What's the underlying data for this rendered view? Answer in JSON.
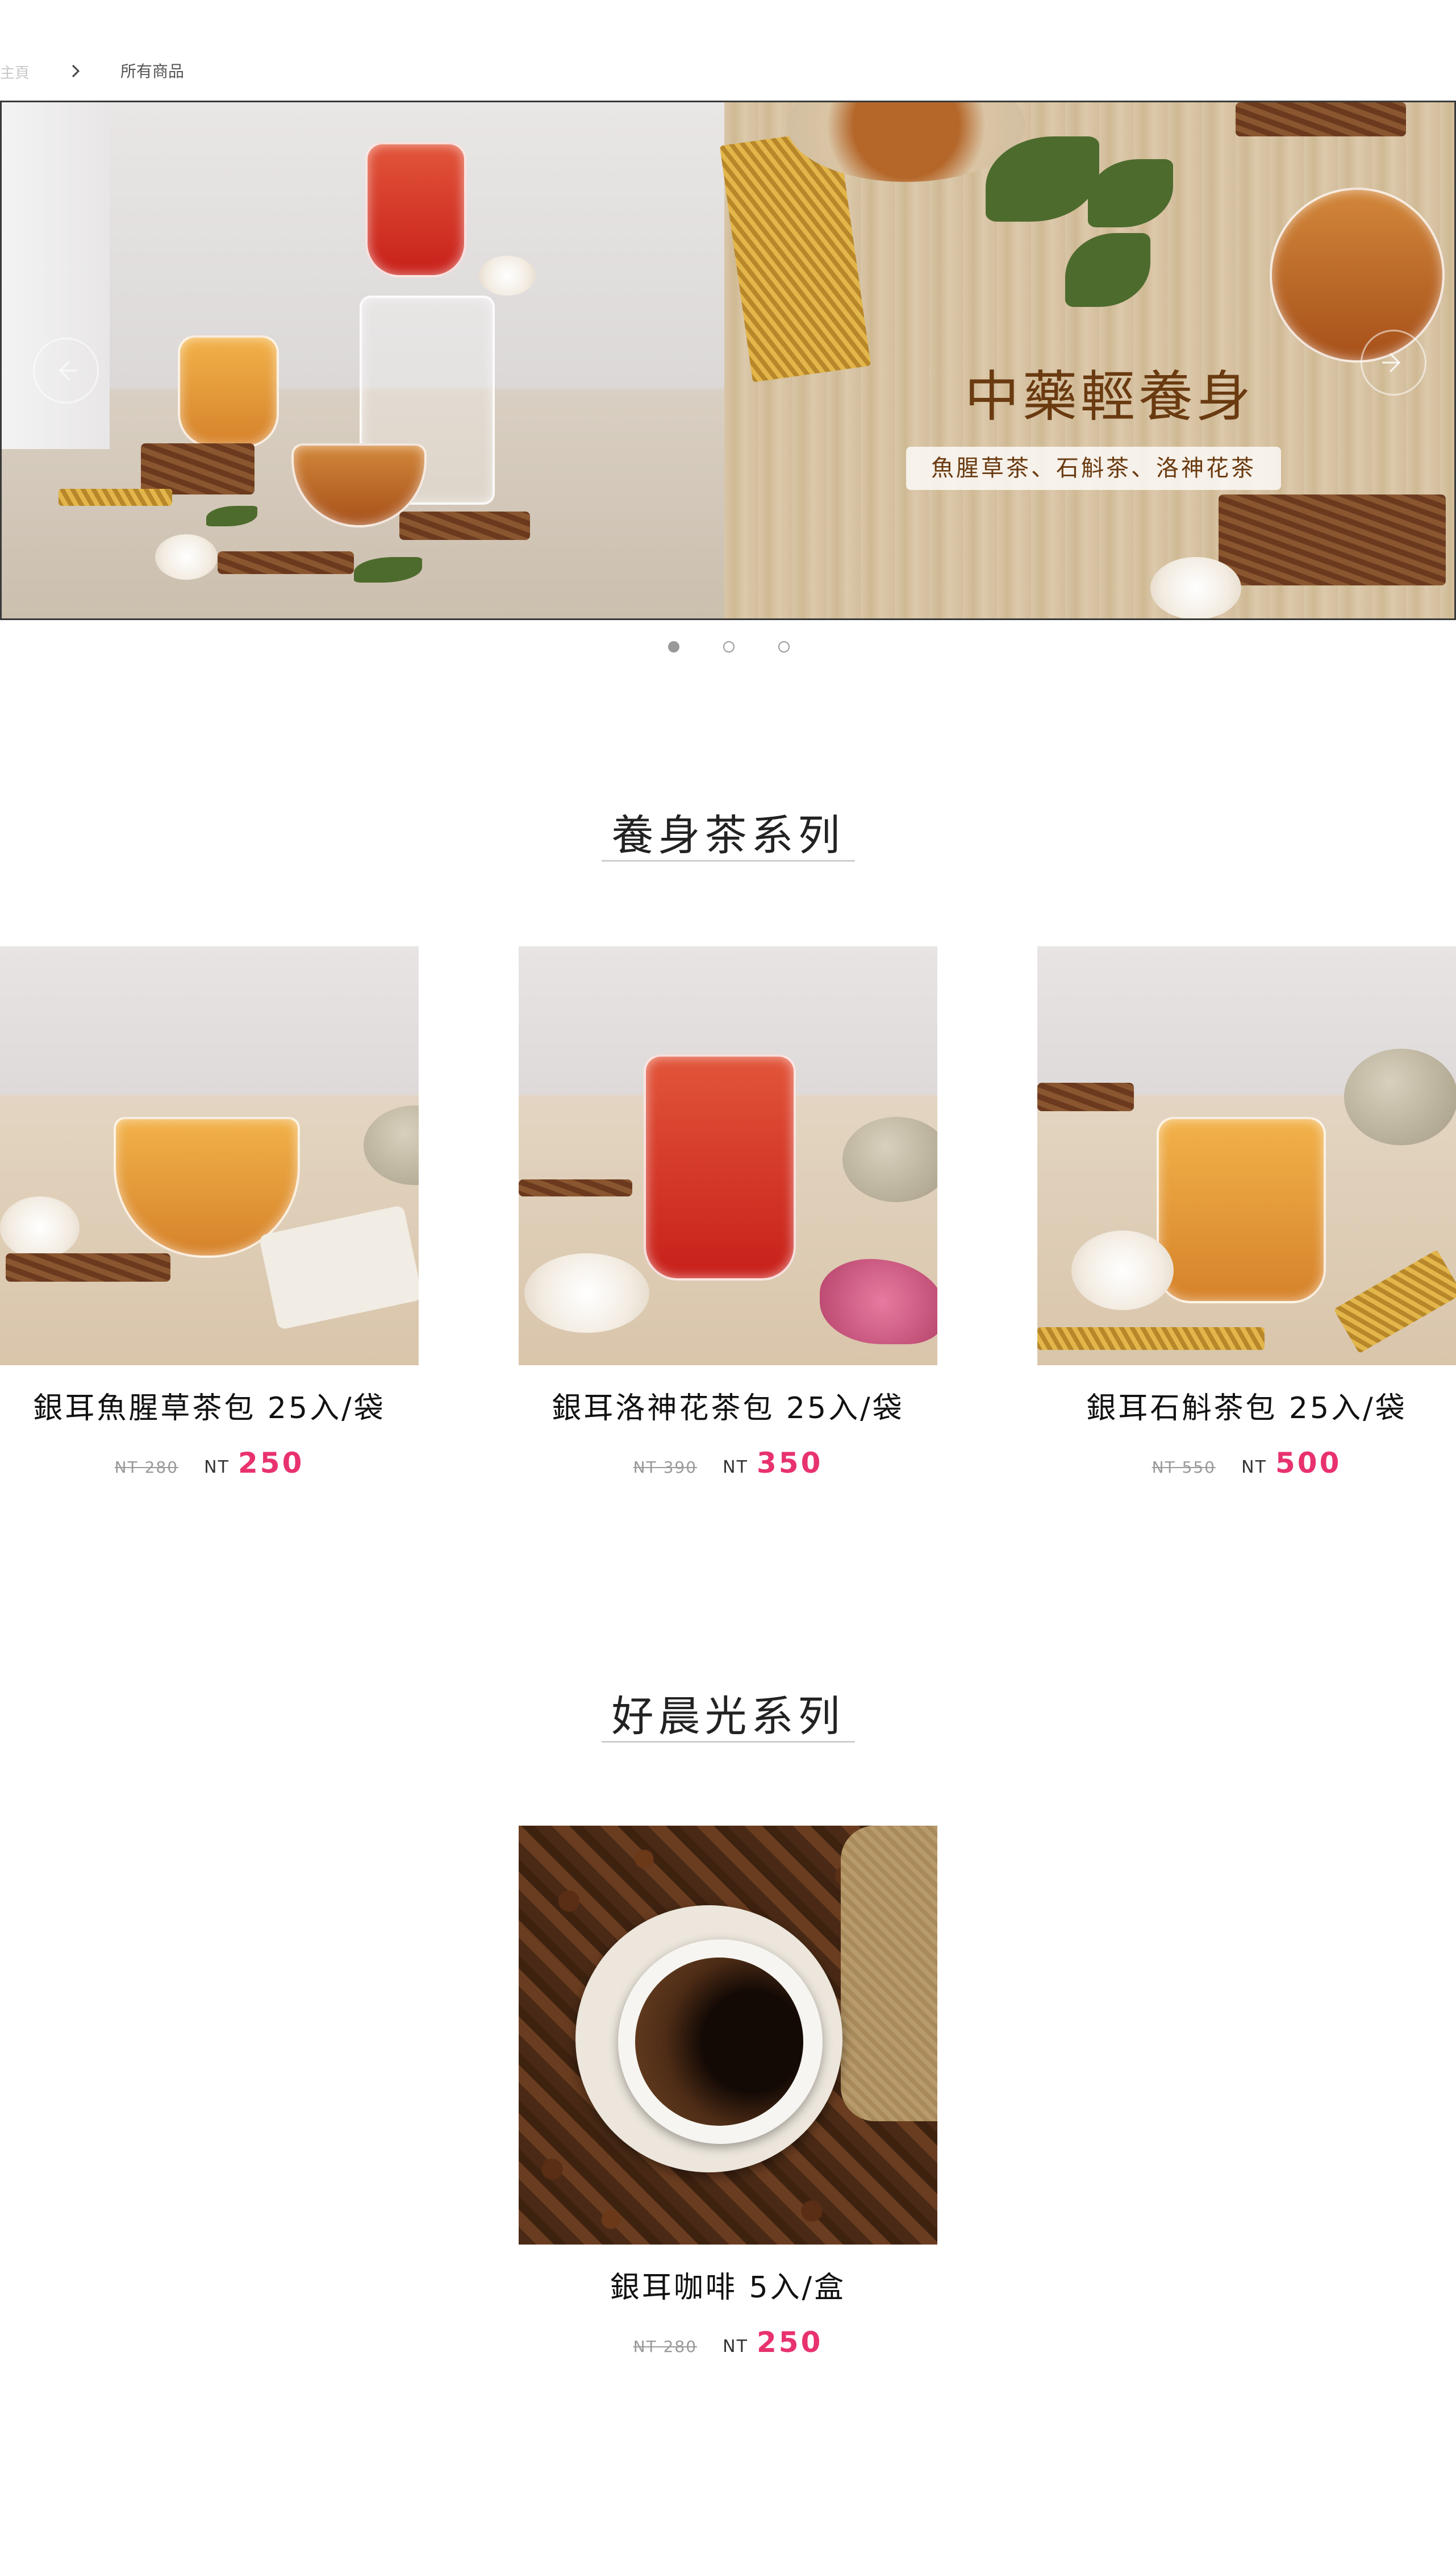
{
  "breadcrumb": {
    "home": "主頁",
    "current": "所有商品"
  },
  "banner": {
    "title": "中藥輕養身",
    "subtitle": "魚腥草茶、石斛茶、洛神花茶",
    "dots": [
      true,
      false,
      false
    ]
  },
  "sections": [
    {
      "title": "養身茶系列",
      "products": [
        {
          "name": "銀耳魚腥草茶包 25入/袋",
          "old_price": "NT 280",
          "currency": "NT",
          "price": "250"
        },
        {
          "name": "銀耳洛神花茶包 25入/袋",
          "old_price": "NT 390",
          "currency": "NT",
          "price": "350"
        },
        {
          "name": "銀耳石斛茶包 25入/袋",
          "old_price": "NT 550",
          "currency": "NT",
          "price": "500"
        }
      ]
    },
    {
      "title": "好晨光系列",
      "products": [
        {
          "name": "銀耳咖啡 5入/盒",
          "old_price": "NT 280",
          "currency": "NT",
          "price": "250"
        }
      ]
    }
  ],
  "colors": {
    "price": "#e8326e",
    "banner_text": "#6a3a10"
  }
}
